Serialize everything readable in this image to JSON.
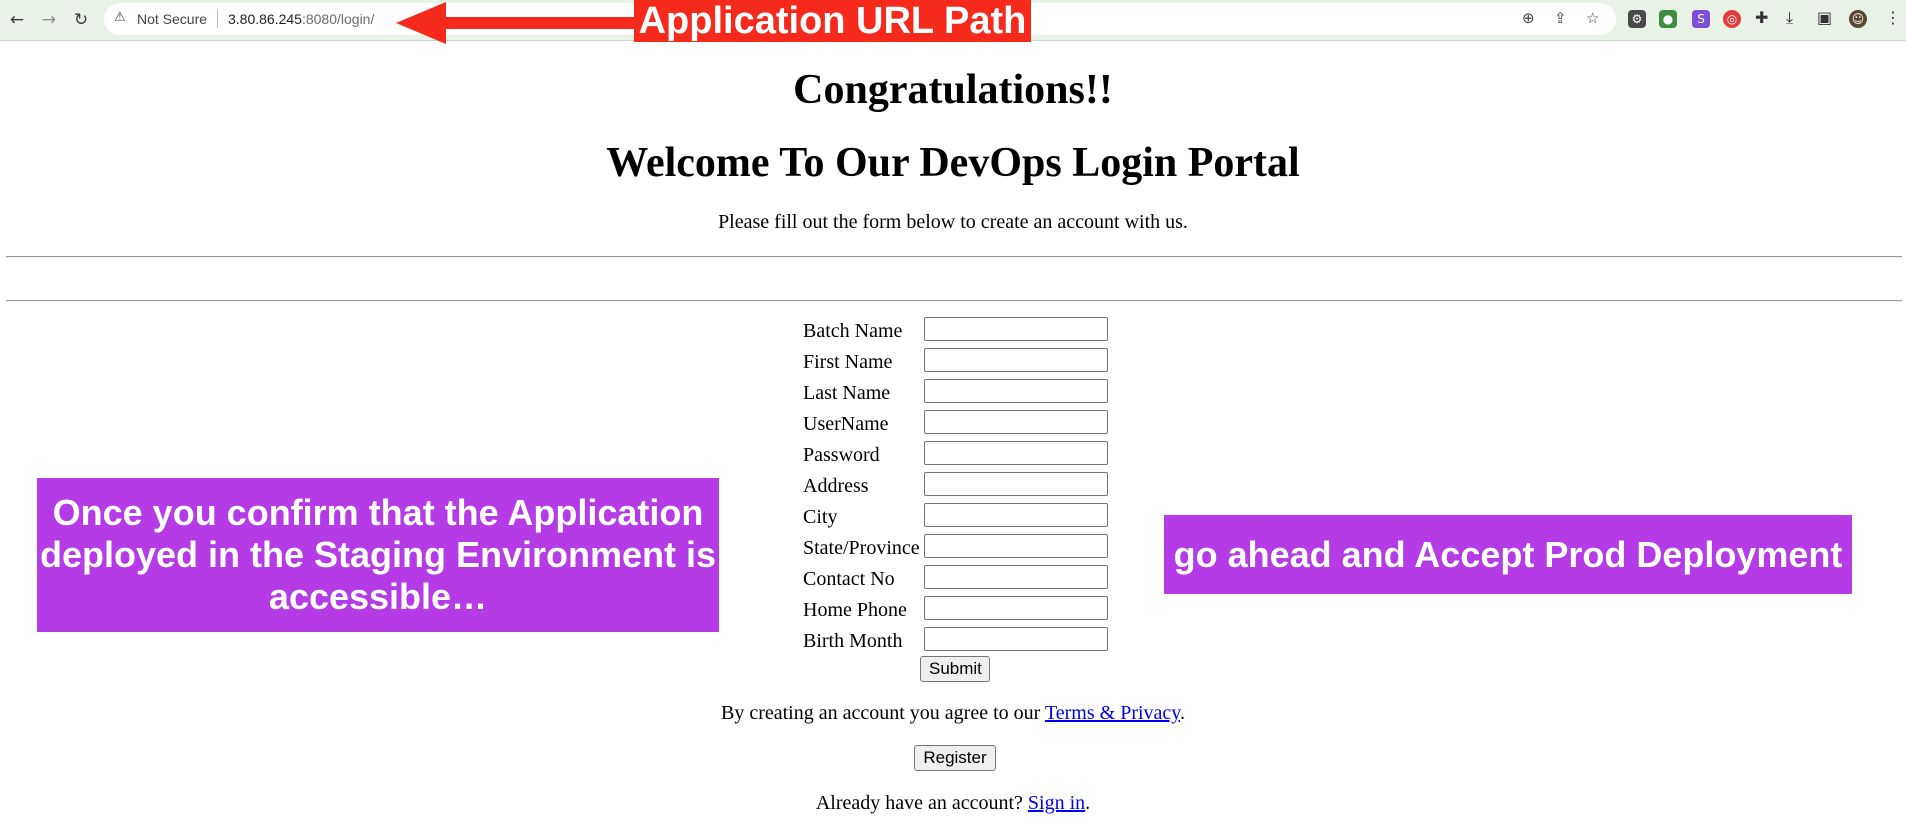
{
  "browser": {
    "security_label": "Not Secure",
    "url_host": "3.80.86.245",
    "url_rest": ":8080/login/"
  },
  "annotations": {
    "url_callout": "Application URL Path",
    "left_callout": "Once you confirm that the Application deployed in the Staging Environment is accessible…",
    "right_callout": "go ahead and Accept Prod Deployment"
  },
  "page": {
    "heading1": "Congratulations!!",
    "heading2": "Welcome To Our DevOps Login Portal",
    "intro": "Please fill out the form below to create an account with us.",
    "form": {
      "fields": [
        {
          "label": "Batch Name",
          "value": ""
        },
        {
          "label": "First Name",
          "value": ""
        },
        {
          "label": "Last Name",
          "value": ""
        },
        {
          "label": "UserName",
          "value": ""
        },
        {
          "label": "Password",
          "value": ""
        },
        {
          "label": "Address",
          "value": ""
        },
        {
          "label": "City",
          "value": ""
        },
        {
          "label": "State/Province",
          "value": ""
        },
        {
          "label": "Contact No",
          "value": ""
        },
        {
          "label": "Home Phone",
          "value": ""
        },
        {
          "label": "Birth Month",
          "value": ""
        }
      ],
      "submit_label": "Submit"
    },
    "terms_prefix": "By creating an account you agree to our ",
    "terms_link": "Terms & Privacy",
    "terms_suffix": ".",
    "register_label": "Register",
    "signin_prefix": "Already have an account? ",
    "signin_link": "Sign in",
    "signin_suffix": "."
  }
}
